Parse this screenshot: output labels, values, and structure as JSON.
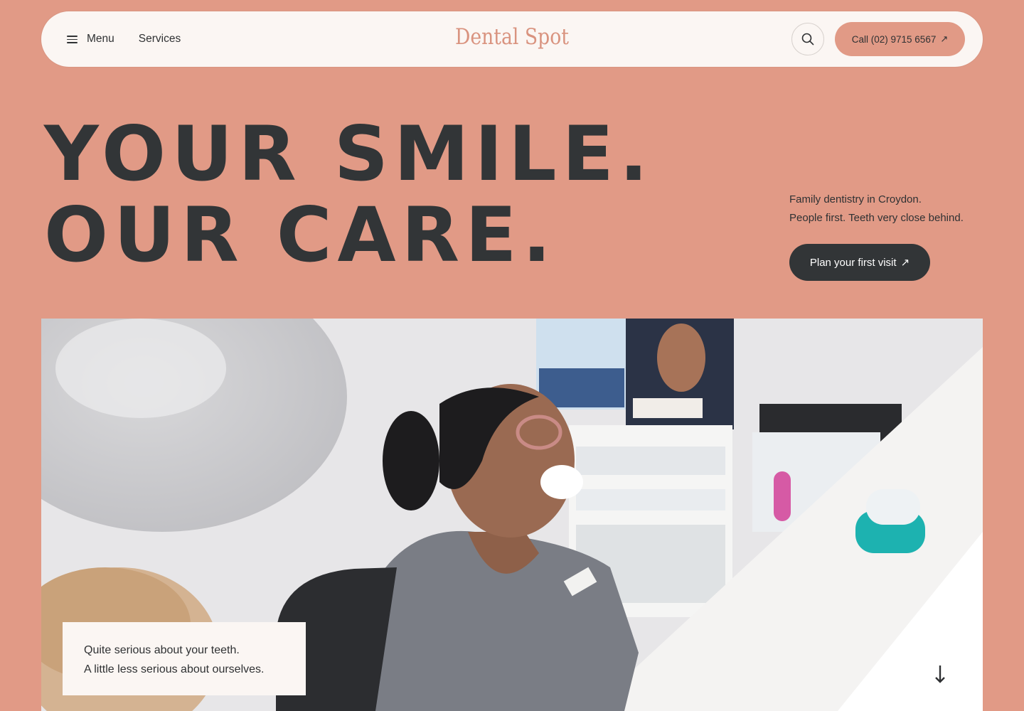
{
  "nav": {
    "menu_label": "Menu",
    "menu_icon": "hamburger-icon",
    "services_label": "Services",
    "logo_text": "Dental Spot",
    "search_icon": "search-icon",
    "call_label": "Call (02) 9715 6567",
    "call_arrow": "↗"
  },
  "hero": {
    "title_line1": "YOUR SMILE.",
    "title_line2": "OUR CARE.",
    "tagline_line1": "Family dentistry in Croydon.",
    "tagline_line2": "People first. Teeth very close behind.",
    "cta_label": "Plan your first visit",
    "cta_arrow": "↗"
  },
  "photo": {
    "caption_line1": "Quite serious about your teeth.",
    "caption_line2": "A little less serious about ourselves.",
    "scroll_icon": "arrow-down-icon"
  },
  "colors": {
    "background": "#e19a86",
    "nav_background": "#fbf6f3",
    "logo": "#d9937f",
    "text_dark": "#323537",
    "cta_background": "#323537"
  }
}
